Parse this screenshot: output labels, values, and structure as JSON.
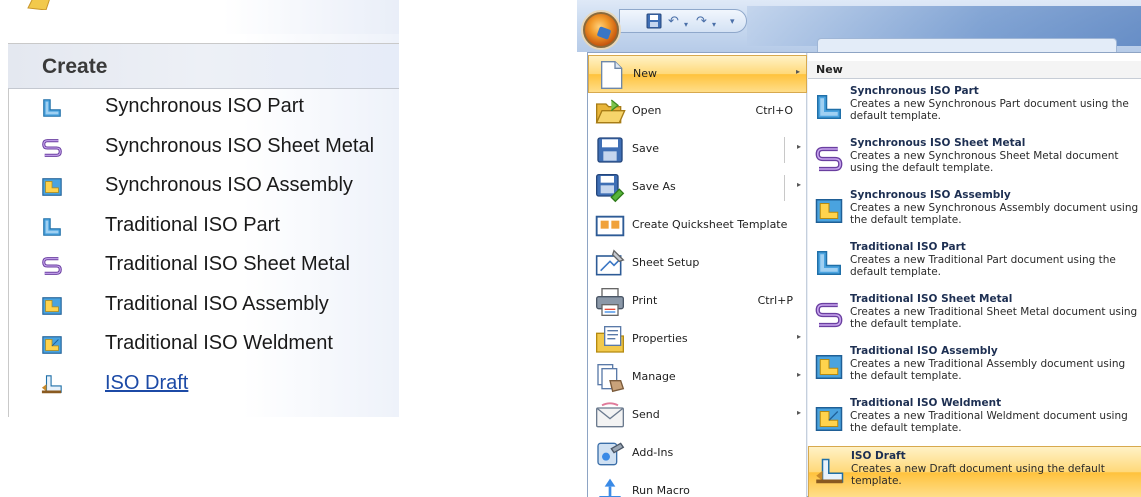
{
  "left": {
    "top_partial_text": "...",
    "section_title": "Create",
    "items": [
      {
        "label": "Synchronous ISO Part",
        "icon": "part-icon"
      },
      {
        "label": "Synchronous ISO Sheet Metal",
        "icon": "sheet-metal-icon"
      },
      {
        "label": "Synchronous ISO Assembly",
        "icon": "assembly-icon"
      },
      {
        "label": "Traditional ISO Part",
        "icon": "part-icon"
      },
      {
        "label": "Traditional ISO Sheet Metal",
        "icon": "sheet-metal-icon"
      },
      {
        "label": "Traditional ISO Assembly",
        "icon": "assembly-icon"
      },
      {
        "label": "Traditional ISO Weldment",
        "icon": "weldment-icon"
      },
      {
        "label": "ISO Draft",
        "icon": "draft-icon"
      }
    ]
  },
  "qat": {
    "save": "H",
    "undo": "↶",
    "redo": "↷",
    "more": "▾"
  },
  "menu": {
    "items": [
      {
        "label": "New",
        "shortcut": "",
        "arrow": "▸",
        "icon": "new-document-icon"
      },
      {
        "label": "Open",
        "shortcut": "Ctrl+O",
        "arrow": "",
        "icon": "open-folder-icon"
      },
      {
        "label": "Save",
        "shortcut": "",
        "arrow": "▸",
        "icon": "save-disk-icon"
      },
      {
        "label": "Save As",
        "shortcut": "",
        "arrow": "▸",
        "icon": "save-as-icon"
      },
      {
        "label": "Create Quicksheet Template",
        "shortcut": "",
        "arrow": "",
        "icon": "quicksheet-icon"
      },
      {
        "label": "Sheet Setup",
        "shortcut": "",
        "arrow": "",
        "icon": "sheet-setup-icon"
      },
      {
        "label": "Print",
        "shortcut": "Ctrl+P",
        "arrow": "",
        "icon": "printer-icon"
      },
      {
        "label": "Properties",
        "shortcut": "",
        "arrow": "▸",
        "icon": "properties-icon"
      },
      {
        "label": "Manage",
        "shortcut": "",
        "arrow": "▸",
        "icon": "manage-icon"
      },
      {
        "label": "Send",
        "shortcut": "",
        "arrow": "▸",
        "icon": "send-mail-icon"
      },
      {
        "label": "Add-Ins",
        "shortcut": "",
        "arrow": "",
        "icon": "add-ins-icon"
      },
      {
        "label": "Run Macro",
        "shortcut": "",
        "arrow": "",
        "icon": "run-macro-icon"
      }
    ]
  },
  "submenu": {
    "header": "New",
    "items": [
      {
        "title": "Synchronous ISO Part",
        "desc": "Creates a new Synchronous Part document using the default template.",
        "icon": "part-icon"
      },
      {
        "title": "Synchronous ISO Sheet Metal",
        "desc": "Creates a new Synchronous Sheet Metal document using the default template.",
        "icon": "sheet-metal-icon"
      },
      {
        "title": "Synchronous ISO Assembly",
        "desc": "Creates a new Synchronous Assembly document using the default template.",
        "icon": "assembly-icon"
      },
      {
        "title": "Traditional ISO Part",
        "desc": "Creates a new Traditional Part document using the default template.",
        "icon": "part-icon"
      },
      {
        "title": "Traditional ISO Sheet Metal",
        "desc": "Creates a new Traditional Sheet Metal document using the default template.",
        "icon": "sheet-metal-icon"
      },
      {
        "title": "Traditional ISO Assembly",
        "desc": "Creates a new Traditional Assembly document using the default template.",
        "icon": "assembly-icon"
      },
      {
        "title": "Traditional ISO Weldment",
        "desc": "Creates a new Traditional Weldment document using the default template.",
        "icon": "weldment-icon"
      },
      {
        "title": "ISO Draft",
        "desc": "Creates a new Draft document using the default template.",
        "icon": "draft-icon"
      }
    ]
  },
  "colors": {
    "hover_gold": "#ffc23c",
    "link_blue": "#1c4aa6",
    "menu_border": "#8ea4c4"
  }
}
